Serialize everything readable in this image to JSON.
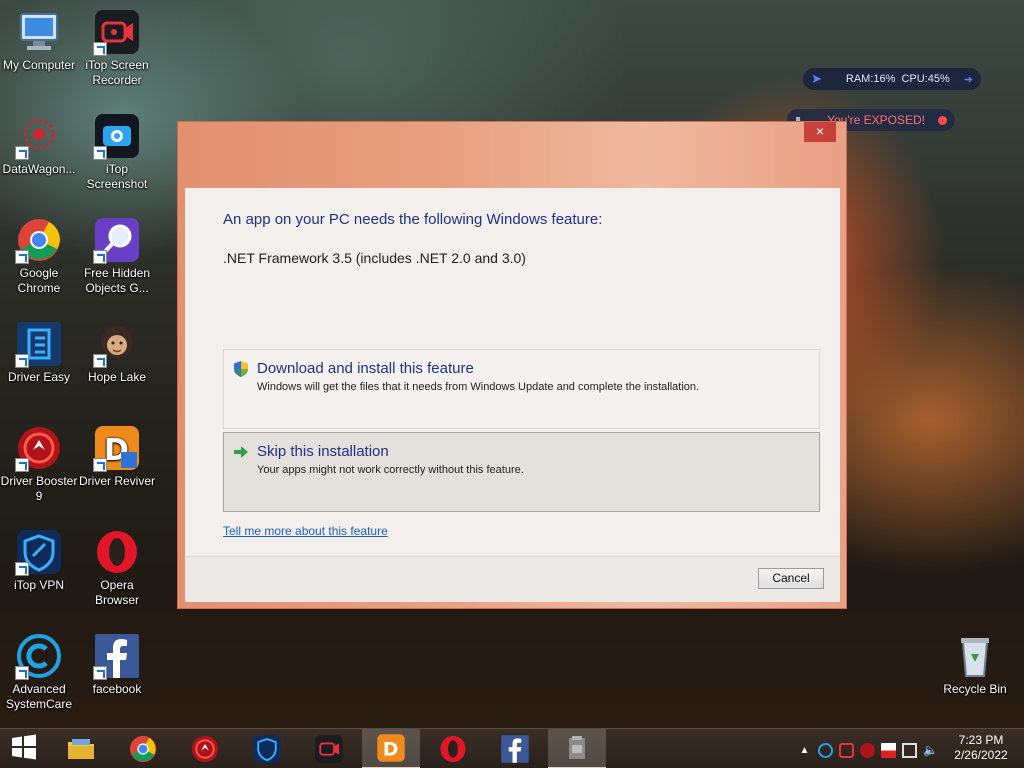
{
  "desktop_icons": [
    {
      "label": "My Computer",
      "icon": "computer-icon"
    },
    {
      "label": "iTop Screen Recorder",
      "icon": "screen-recorder-icon"
    },
    {
      "label": "DataWagon...",
      "icon": "datawagon-icon"
    },
    {
      "label": "iTop Screenshot",
      "icon": "screenshot-icon"
    },
    {
      "label": "Google Chrome",
      "icon": "chrome-icon"
    },
    {
      "label": "Free Hidden Objects G...",
      "icon": "magnifier-icon"
    },
    {
      "label": "Driver Easy",
      "icon": "driver-easy-icon"
    },
    {
      "label": "Hope Lake",
      "icon": "hope-lake-icon"
    },
    {
      "label": "Driver Booster 9",
      "icon": "driver-booster-icon"
    },
    {
      "label": "Driver Reviver",
      "icon": "driver-reviver-icon"
    },
    {
      "label": "iTop VPN",
      "icon": "vpn-icon"
    },
    {
      "label": "Opera Browser",
      "icon": "opera-icon"
    },
    {
      "label": "Advanced SystemCare",
      "icon": "systemcare-icon"
    },
    {
      "label": "facebook",
      "icon": "facebook-icon"
    },
    {
      "label": "Recycle Bin",
      "icon": "recycle-bin-icon"
    }
  ],
  "widgets": {
    "perf": {
      "ram": "RAM:16%",
      "cpu": "CPU:45%"
    },
    "vpn": {
      "status": "You're EXPOSED!"
    }
  },
  "dialog": {
    "close_label": "×",
    "heading": "An app on your PC needs the following Windows feature:",
    "feature": ".NET Framework 3.5 (includes .NET 2.0 and 3.0)",
    "options": [
      {
        "title": "Download and install this feature",
        "desc": "Windows will get the files that it needs from Windows Update and complete the installation."
      },
      {
        "title": "Skip this installation",
        "desc": "Your apps might not work correctly without this feature."
      }
    ],
    "link": "Tell me more about this feature",
    "cancel_label": "Cancel"
  },
  "taskbar": {
    "items": [
      "start-button",
      "file-explorer",
      "chrome",
      "driver-booster",
      "itop-vpn",
      "itop-screen-recorder",
      "driver-reviver",
      "opera",
      "facebook",
      "installer"
    ],
    "clock_time": "7:23 PM",
    "clock_date": "2/26/2022"
  }
}
